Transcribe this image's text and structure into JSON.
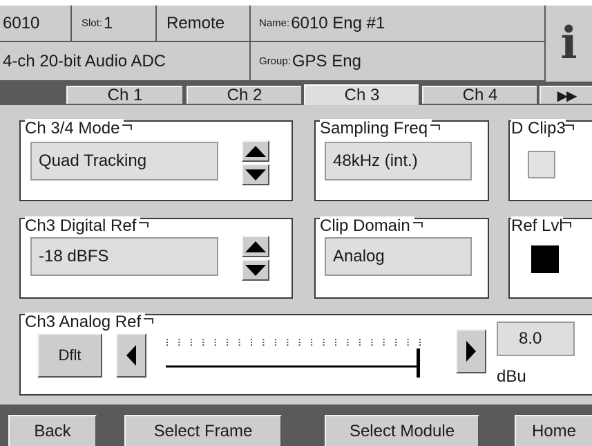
{
  "header": {
    "model": "6010",
    "slot_label": "Slot:",
    "slot_value": "1",
    "mode": "Remote",
    "name_label": "Name:",
    "name_value": "6010 Eng #1",
    "description": "4-ch 20-bit Audio ADC",
    "group_label": "Group:",
    "group_value": "GPS Eng",
    "info_glyph": "i"
  },
  "tabs": [
    {
      "label": "Ch 1",
      "active": false
    },
    {
      "label": "Ch 2",
      "active": false
    },
    {
      "label": "Ch 3",
      "active": true
    },
    {
      "label": "Ch 4",
      "active": false
    }
  ],
  "tab_more": "▶▶",
  "panels": {
    "mode": {
      "title": "Ch 3/4 Mode",
      "value": "Quad Tracking"
    },
    "sampling": {
      "title": "Sampling Freq",
      "value": "48kHz (int.)"
    },
    "dclip": {
      "title": "D Clip3",
      "checked": false
    },
    "digital_ref": {
      "title": "Ch3 Digital Ref",
      "value": "-18 dBFS"
    },
    "clip_domain": {
      "title": "Clip Domain",
      "value": "Analog"
    },
    "ref_lvl": {
      "title": "Ref Lvl",
      "indicator_color": "#000000"
    },
    "analog_ref": {
      "title": "Ch3 Analog Ref",
      "default_button": "Dflt",
      "value": "8.0",
      "unit": "dBu",
      "slider_position": 1.0
    }
  },
  "footer": {
    "back": "Back",
    "select_frame": "Select Frame",
    "select_module": "Select Module",
    "home": "Home"
  },
  "colors": {
    "background_dark": "#5a5a5a",
    "control_gray": "#cdcdcd",
    "field_gray": "#dedede"
  }
}
